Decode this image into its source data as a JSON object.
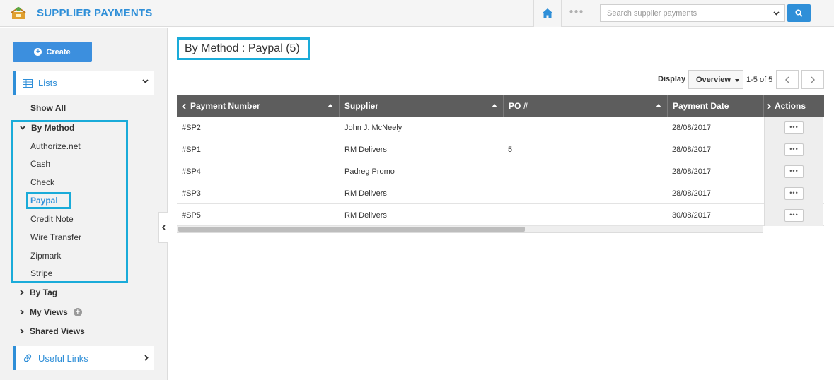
{
  "header": {
    "title": "SUPPLIER PAYMENTS",
    "search_placeholder": "Search supplier payments",
    "icons": [
      "app-logo-icon",
      "home-icon",
      "more-dots-icon",
      "chevron-down-icon",
      "search-icon"
    ],
    "colors": {
      "brand": "#2f8fd8",
      "highlight": "#1aabd9"
    }
  },
  "sidebar": {
    "create_label": "Create",
    "lists_label": "Lists",
    "show_all": "Show All",
    "by_method_label": "By Method",
    "methods": [
      "Authorize.net",
      "Cash",
      "Check",
      "Paypal",
      "Credit Note",
      "Wire Transfer",
      "Zipmark",
      "Stripe"
    ],
    "selected_method": "Paypal",
    "by_tag": "By Tag",
    "my_views": "My Views",
    "shared_views": "Shared Views",
    "useful_links": "Useful Links"
  },
  "main": {
    "page_title": "By Method : Paypal (5)",
    "display_label": "Display",
    "display_value": "Overview",
    "page_count": "1-5 of 5",
    "columns": [
      "Payment Number",
      "Supplier",
      "PO #",
      "Payment Date",
      "Actions"
    ],
    "rows": [
      {
        "number": "#SP2",
        "supplier": "John J. McNeely",
        "po": "",
        "date": "28/08/2017"
      },
      {
        "number": "#SP1",
        "supplier": "RM Delivers",
        "po": "5",
        "date": "28/08/2017"
      },
      {
        "number": "#SP4",
        "supplier": "Padreg Promo",
        "po": "",
        "date": "28/08/2017"
      },
      {
        "number": "#SP3",
        "supplier": "RM Delivers",
        "po": "",
        "date": "28/08/2017"
      },
      {
        "number": "#SP5",
        "supplier": "RM Delivers",
        "po": "",
        "date": "30/08/2017"
      }
    ],
    "more_label": "•••"
  }
}
